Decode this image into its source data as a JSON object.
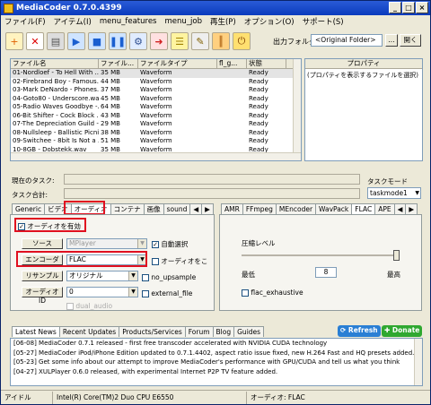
{
  "window": {
    "title": "MediaCoder 0.7.0.4399",
    "controls": [
      "_",
      "□",
      "×"
    ]
  },
  "menu": [
    "ファイル(F)",
    "アイテム(I)",
    "menu_features",
    "menu_job",
    "再生(P)",
    "オプション(O)",
    "サポート(S)"
  ],
  "toolbar": {
    "icons": [
      "add-file-icon",
      "remove-icon",
      "trash-icon",
      "play-icon",
      "stop-icon",
      "pause-icon",
      "settings-icon",
      "transcode-icon",
      "list-icon",
      "wrench-icon",
      "bars-icon",
      "exit-icon"
    ],
    "output_label": "出力フォルダ",
    "output_value": "<Original Folder>",
    "browse": "...",
    "open": "開く"
  },
  "files": {
    "headers": [
      "ファイル名",
      "ファイル...",
      "ファイルタイプ",
      "fl_g...",
      "状態"
    ],
    "rows": [
      [
        "01-Nordloef - To Hell With ...",
        "35 MB",
        "Waveform",
        "",
        "Ready"
      ],
      [
        "02-Firebrand Boy - Famous...",
        "44 MB",
        "Waveform",
        "",
        "Ready"
      ],
      [
        "03-Mark DeNardo - Phones...",
        "37 MB",
        "Waveform",
        "",
        "Ready"
      ],
      [
        "04-Goto80 - Underscore.wav",
        "45 MB",
        "Waveform",
        "",
        "Ready"
      ],
      [
        "05-Radio Waves Goodbye -...",
        "64 MB",
        "Waveform",
        "",
        "Ready"
      ],
      [
        "06-Bit Shifter - Cock Block ...",
        "43 MB",
        "Waveform",
        "",
        "Ready"
      ],
      [
        "07-The Depreciation Guild -...",
        "29 MB",
        "Waveform",
        "",
        "Ready"
      ],
      [
        "08-Nullsleep - Ballistic Picnic...",
        "38 MB",
        "Waveform",
        "",
        "Ready"
      ],
      [
        "09-Switchee - 8bit Is Not a ...",
        "51 MB",
        "Waveform",
        "",
        "Ready"
      ],
      [
        "10-8GB - Dobstekk.wav",
        "35 MB",
        "Waveform",
        "",
        "Ready"
      ]
    ]
  },
  "properties": {
    "header": "プロパティ",
    "hint": "(プロパティを表示するファイルを選択)"
  },
  "task": {
    "current_label": "現在のタスク:",
    "total_label": "タスク合計:",
    "mode_label": "タスクモード",
    "mode_value": "taskmode1"
  },
  "left_tabs": [
    "Generic",
    "ビデオ",
    "オーディオ",
    "コンテナ",
    "画像",
    "sound"
  ],
  "right_tabs": [
    "AMR",
    "FFmpeg",
    "MEncoder",
    "WavPack",
    "FLAC",
    "APE"
  ],
  "audio": {
    "enable": "オーディオを有効",
    "source_btn": "ソース",
    "source_val": "MPlayer",
    "auto_select": "自動選択",
    "encoder_btn": "エンコーダ",
    "encoder_val": "FLAC",
    "audio_opt": "オーディオをこ",
    "resample_btn": "リサンプル",
    "resample_val": "オリジナル",
    "no_upsample": "no_upsample",
    "audio_id_btn": "オーディオID",
    "audio_id_val": "0",
    "external": "external_file",
    "dual": "dual_audio"
  },
  "flac": {
    "level_label": "圧縮レベル",
    "min": "最低",
    "value": "8",
    "max": "最高",
    "exhaustive": "flac_exhaustive"
  },
  "news_tabs": [
    "Latest News",
    "Recent Updates",
    "Products/Services",
    "Forum",
    "Blog",
    "Guides"
  ],
  "news_buttons": {
    "refresh": "Refresh",
    "donate": "Donate"
  },
  "news": [
    "[06-08] MediaCoder 0.7.1 released - first free transcoder accelerated with NVIDIA CUDA technology",
    "[05-27] MediaCoder iPod/iPhone Edition updated to 0.7.1.4402, aspect ratio issue fixed, new H.264 Fast and HQ presets added.",
    "[05-23] Get some info about our attempt to improve MediaCoder's performance with GPU/CUDA and tell us what you think",
    "[04-27] XULPlayer 0.6.0 released, with experimental Internet P2P TV feature added."
  ],
  "status": [
    "アイドル",
    "Intel(R) Core(TM)2 Duo CPU E6550",
    "オーディオ: FLAC"
  ]
}
